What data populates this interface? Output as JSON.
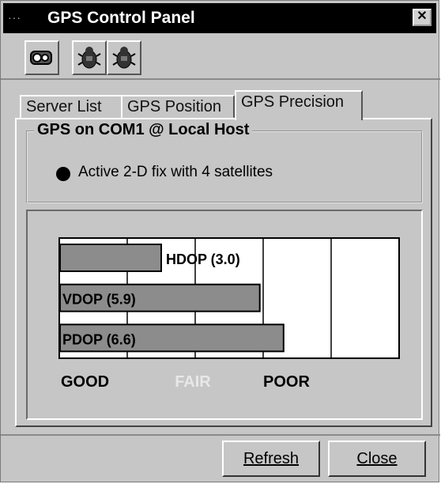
{
  "window": {
    "title": "GPS Control Panel",
    "title_dots": "···",
    "close_symbol": "✕"
  },
  "toolbar": {
    "buttons": [
      {
        "icon": "satellite-icon"
      },
      {
        "icon": "bug-icon"
      },
      {
        "icon": "bug-icon"
      }
    ]
  },
  "tabs": [
    {
      "label": "Server List",
      "active": false
    },
    {
      "label": "GPS Position",
      "active": false
    },
    {
      "label": "GPS Precision",
      "active": true
    }
  ],
  "group": {
    "title": "GPS on COM1 @ Local Host",
    "status": "Active 2-D fix with 4 satellites"
  },
  "chart_data": {
    "type": "bar",
    "orientation": "horizontal",
    "categories": [
      "HDOP (3.0)",
      "VDOP (5.9)",
      "PDOP (6.6)"
    ],
    "values": [
      3.0,
      5.9,
      6.6
    ],
    "xlim": [
      0,
      10
    ],
    "x_tick_labels": [
      "GOOD",
      "FAIR",
      "POOR"
    ],
    "grid": true
  },
  "colors": {
    "bar": "#8c8c8c",
    "plot_background": "#ffffff"
  },
  "buttons": {
    "refresh": "Refresh",
    "close": "Close"
  }
}
